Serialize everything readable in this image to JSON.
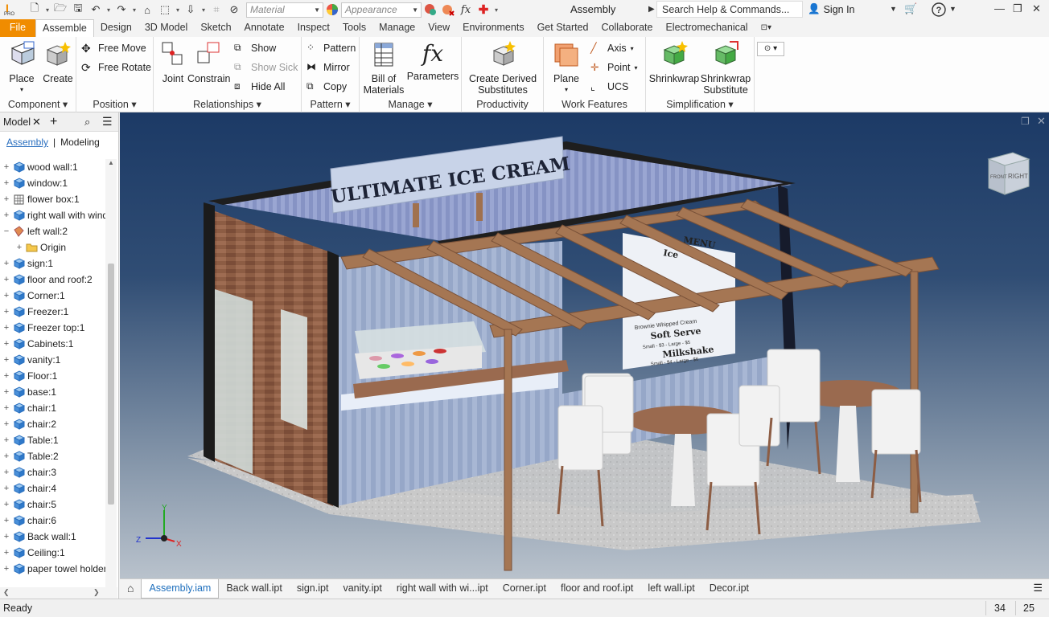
{
  "titlebar": {
    "material_placeholder": "Material",
    "appearance_placeholder": "Appearance",
    "app_title": "Assembly",
    "search_text": "Search Help & Commands...",
    "sign_in": "Sign In",
    "pro_badge": "PRO"
  },
  "tabs": [
    "File",
    "Assemble",
    "Design",
    "3D Model",
    "Sketch",
    "Annotate",
    "Inspect",
    "Tools",
    "Manage",
    "View",
    "Environments",
    "Get Started",
    "Collaborate",
    "Electromechanical"
  ],
  "active_tab": "Assemble",
  "ribbon": {
    "component": {
      "title": "Component",
      "place": "Place",
      "create": "Create"
    },
    "position": {
      "title": "Position",
      "free_move": "Free Move",
      "free_rotate": "Free Rotate"
    },
    "relationships": {
      "title": "Relationships",
      "joint": "Joint",
      "constrain": "Constrain",
      "show": "Show",
      "show_sick": "Show Sick",
      "hide_all": "Hide All"
    },
    "pattern": {
      "title": "Pattern",
      "pattern": "Pattern",
      "mirror": "Mirror",
      "copy": "Copy"
    },
    "manage": {
      "title": "Manage",
      "bom_1": "Bill of",
      "bom_2": "Materials",
      "parameters": "Parameters"
    },
    "productivity": {
      "title": "Productivity",
      "derived_1": "Create Derived",
      "derived_2": "Substitutes"
    },
    "work_features": {
      "title": "Work Features",
      "plane": "Plane",
      "axis": "Axis",
      "point": "Point",
      "ucs": "UCS"
    },
    "simplification": {
      "title": "Simplification",
      "shrinkwrap": "Shrinkwrap",
      "sws_1": "Shrinkwrap",
      "sws_2": "Substitute"
    }
  },
  "browser": {
    "title": "Model",
    "tab_assembly": "Assembly",
    "tab_modeling": "Modeling",
    "items": [
      {
        "label": "wood wall:1",
        "expander": "+",
        "icon": "cube"
      },
      {
        "label": "window:1",
        "expander": "+",
        "icon": "cube"
      },
      {
        "label": "flower box:1",
        "expander": "+",
        "icon": "grid-cube"
      },
      {
        "label": "right wall with wind",
        "expander": "+",
        "icon": "cube"
      },
      {
        "label": "left wall:2",
        "expander": "−",
        "icon": "part"
      },
      {
        "label": "Origin",
        "expander": "+",
        "icon": "folder",
        "indent": true
      },
      {
        "label": "sign:1",
        "expander": "+",
        "icon": "cube"
      },
      {
        "label": "floor and roof:2",
        "expander": "+",
        "icon": "cube"
      },
      {
        "label": "Corner:1",
        "expander": "+",
        "icon": "cube"
      },
      {
        "label": "Freezer:1",
        "expander": "+",
        "icon": "cube"
      },
      {
        "label": "Freezer top:1",
        "expander": "+",
        "icon": "cube"
      },
      {
        "label": "Cabinets:1",
        "expander": "+",
        "icon": "cube"
      },
      {
        "label": "vanity:1",
        "expander": "+",
        "icon": "cube"
      },
      {
        "label": "Floor:1",
        "expander": "+",
        "icon": "cube"
      },
      {
        "label": "base:1",
        "expander": "+",
        "icon": "cube"
      },
      {
        "label": "chair:1",
        "expander": "+",
        "icon": "cube"
      },
      {
        "label": "chair:2",
        "expander": "+",
        "icon": "cube"
      },
      {
        "label": "Table:1",
        "expander": "+",
        "icon": "cube"
      },
      {
        "label": "Table:2",
        "expander": "+",
        "icon": "cube"
      },
      {
        "label": "chair:3",
        "expander": "+",
        "icon": "cube"
      },
      {
        "label": "chair:4",
        "expander": "+",
        "icon": "cube"
      },
      {
        "label": "chair:5",
        "expander": "+",
        "icon": "cube"
      },
      {
        "label": "chair:6",
        "expander": "+",
        "icon": "cube"
      },
      {
        "label": "Back wall:1",
        "expander": "+",
        "icon": "cube"
      },
      {
        "label": "Ceiling:1",
        "expander": "+",
        "icon": "cube"
      },
      {
        "label": "paper towel holder",
        "expander": "+",
        "icon": "cube"
      }
    ]
  },
  "viewport": {
    "sign_text": "ULTIMATE ICE CREAM",
    "menu_heading": "MENU",
    "menu_line_1": "Ice",
    "menu_soft_serve": "Soft Serve",
    "menu_soft_prices": "Small - $3 - Large - $5",
    "menu_milkshake": "Milkshake",
    "menu_shake_prices": "Small - $4 - Large - $6",
    "menu_brownie": "Brownie Whipped Cream",
    "viewcube_front": "FRONT",
    "viewcube_right": "RIGHT",
    "axis_x": "X",
    "axis_y": "Y",
    "axis_z": "Z"
  },
  "doc_tabs": [
    "Assembly.iam",
    "Back wall.ipt",
    "sign.ipt",
    "vanity.ipt",
    "right wall with wi...ipt",
    "Corner.ipt",
    "floor and roof.ipt",
    "left wall.ipt",
    "Decor.ipt"
  ],
  "status": {
    "text": "Ready",
    "count_1": "34",
    "count_2": "25"
  },
  "colors": {
    "file_tab": "#f08c00",
    "accent_blue": "#1e6fbd",
    "viewport_top": "#1c3a66",
    "viewport_bottom": "#b9c2cc"
  }
}
